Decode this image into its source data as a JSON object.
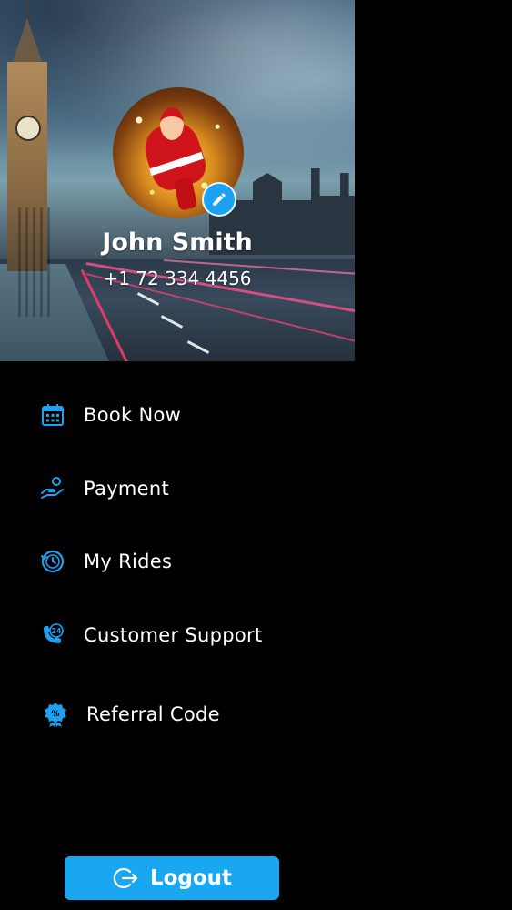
{
  "profile": {
    "name": "John Smith",
    "phone": "+1 72 334 4456",
    "edit_icon": "pencil-icon"
  },
  "menu": {
    "items": [
      {
        "label": "Book Now",
        "icon": "calendar-icon"
      },
      {
        "label": "Payment",
        "icon": "hand-coin-icon"
      },
      {
        "label": "My Rides",
        "icon": "history-clock-icon"
      },
      {
        "label": "Customer Support",
        "icon": "phone-24-icon"
      },
      {
        "label": "Referral Code",
        "icon": "badge-percent-icon"
      }
    ]
  },
  "logout": {
    "label": "Logout",
    "icon": "logout-icon"
  },
  "colors": {
    "accent": "#1da1f2",
    "background": "#000000",
    "text": "#ffffff"
  }
}
